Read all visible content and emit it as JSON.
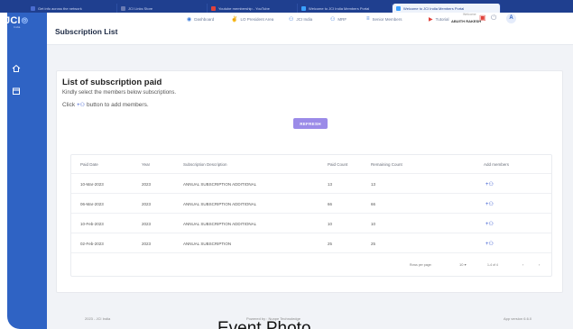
{
  "browser_tabs": [
    {
      "label": "Get info across the network",
      "icon_color": "#4a6cd0"
    },
    {
      "label": "JCI Links Store",
      "icon_color": "#6a7bb3"
    },
    {
      "label": "Youtube membership - YouTube",
      "icon_color": "#e0423b"
    },
    {
      "label": "Welcome to JCI India Members Portal",
      "icon_color": "#3aa0ff"
    },
    {
      "label": "Welcome to JCI India Members Portal",
      "icon_color": "#3aa0ff",
      "active": true
    }
  ],
  "logo": {
    "text": "JCI",
    "sub": "India"
  },
  "appbar": {
    "title": "Subscription List",
    "nav": [
      {
        "label": "Dashboard",
        "icon": "dashboard-icon",
        "glyph": "◉",
        "color": "#3b7bdc"
      },
      {
        "label": "LO President Area",
        "icon": "handshake-icon",
        "glyph": "✌",
        "color": "#3b7bdc"
      },
      {
        "label": "JCI India",
        "icon": "people-icon",
        "glyph": "👥",
        "color": "#3b7bdc"
      },
      {
        "label": "MRF",
        "icon": "people-icon",
        "glyph": "👥",
        "color": "#3b7bdc"
      },
      {
        "label": "Senior Members",
        "icon": "list-icon",
        "glyph": "≡",
        "color": "#3b7bdc"
      },
      {
        "label": "Tutorial",
        "icon": "youtube-icon",
        "glyph": "▶",
        "color": "#e0423b"
      }
    ],
    "welcome": "Welcome",
    "user_name": "ABUITH RAKESH",
    "avatar": "A"
  },
  "card": {
    "title": "List of subscription paid",
    "line1": "Kindly select the members below subscriptions.",
    "line2_before": "Click",
    "line2_after": "button to add members.",
    "refresh_label": "REFRESH"
  },
  "table": {
    "headers": [
      "Paid Date",
      "Year",
      "Subscription Description",
      "Paid Count",
      "Remaining Count",
      "Add members"
    ],
    "rows": [
      [
        "10-Mar-2023",
        "2023",
        "ANNUAL SUBSCRIPTION ADDITIONAL",
        "13",
        "13"
      ],
      [
        "06-Mar-2023",
        "2023",
        "ANNUAL SUBSCRIPTION ADDITIONAL",
        "66",
        "66"
      ],
      [
        "10-Feb-2023",
        "2023",
        "ANNUAL SUBSCRIPTION ADDITIONAL",
        "10",
        "10"
      ],
      [
        "02-Feb-2023",
        "2023",
        "ANNUAL SUBSCRIPTION",
        "25",
        "25"
      ]
    ],
    "pager": {
      "rows_label": "Rows per page:",
      "rows_value": "10",
      "range": "1-4 of 4"
    }
  },
  "footer": {
    "copyright": "2023 - JCI India",
    "powered": "Powered by : Nunpe Technoledge",
    "version": "App version 6.6.0"
  },
  "overlay_text": "Event Photo"
}
